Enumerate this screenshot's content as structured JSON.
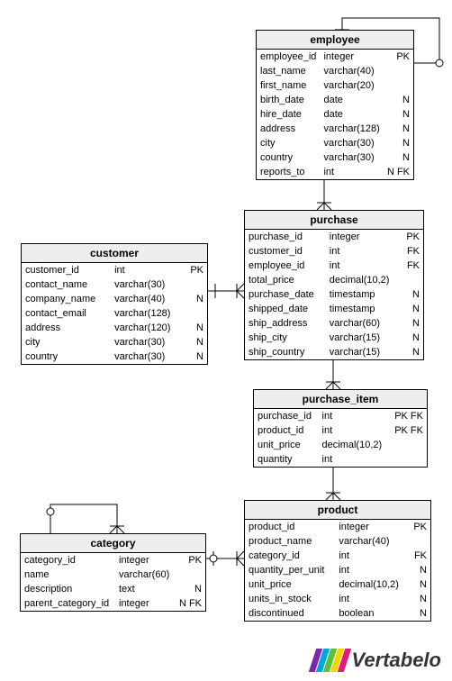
{
  "logo_text": "Vertabelo",
  "entities": {
    "employee": {
      "name": "employee",
      "columns": [
        {
          "name": "employee_id",
          "type": "integer",
          "flags": "PK"
        },
        {
          "name": "last_name",
          "type": "varchar(40)",
          "flags": ""
        },
        {
          "name": "first_name",
          "type": "varchar(20)",
          "flags": ""
        },
        {
          "name": "birth_date",
          "type": "date",
          "flags": "N"
        },
        {
          "name": "hire_date",
          "type": "date",
          "flags": "N"
        },
        {
          "name": "address",
          "type": "varchar(128)",
          "flags": "N"
        },
        {
          "name": "city",
          "type": "varchar(30)",
          "flags": "N"
        },
        {
          "name": "country",
          "type": "varchar(30)",
          "flags": "N"
        },
        {
          "name": "reports_to",
          "type": "int",
          "flags": "N FK"
        }
      ]
    },
    "customer": {
      "name": "customer",
      "columns": [
        {
          "name": "customer_id",
          "type": "int",
          "flags": "PK"
        },
        {
          "name": "contact_name",
          "type": "varchar(30)",
          "flags": ""
        },
        {
          "name": "company_name",
          "type": "varchar(40)",
          "flags": "N"
        },
        {
          "name": "contact_email",
          "type": "varchar(128)",
          "flags": ""
        },
        {
          "name": "address",
          "type": "varchar(120)",
          "flags": "N"
        },
        {
          "name": "city",
          "type": "varchar(30)",
          "flags": "N"
        },
        {
          "name": "country",
          "type": "varchar(30)",
          "flags": "N"
        }
      ]
    },
    "purchase": {
      "name": "purchase",
      "columns": [
        {
          "name": "purchase_id",
          "type": "integer",
          "flags": "PK"
        },
        {
          "name": "customer_id",
          "type": "int",
          "flags": "FK"
        },
        {
          "name": "employee_id",
          "type": "int",
          "flags": "FK"
        },
        {
          "name": "total_price",
          "type": "decimal(10,2)",
          "flags": ""
        },
        {
          "name": "purchase_date",
          "type": "timestamp",
          "flags": "N"
        },
        {
          "name": "shipped_date",
          "type": "timestamp",
          "flags": "N"
        },
        {
          "name": "ship_address",
          "type": "varchar(60)",
          "flags": "N"
        },
        {
          "name": "ship_city",
          "type": "varchar(15)",
          "flags": "N"
        },
        {
          "name": "ship_country",
          "type": "varchar(15)",
          "flags": "N"
        }
      ]
    },
    "purchase_item": {
      "name": "purchase_item",
      "columns": [
        {
          "name": "purchase_id",
          "type": "int",
          "flags": "PK FK"
        },
        {
          "name": "product_id",
          "type": "int",
          "flags": "PK FK"
        },
        {
          "name": "unit_price",
          "type": "decimal(10,2)",
          "flags": ""
        },
        {
          "name": "quantity",
          "type": "int",
          "flags": ""
        }
      ]
    },
    "product": {
      "name": "product",
      "columns": [
        {
          "name": "product_id",
          "type": "integer",
          "flags": "PK"
        },
        {
          "name": "product_name",
          "type": "varchar(40)",
          "flags": ""
        },
        {
          "name": "category_id",
          "type": "int",
          "flags": "FK"
        },
        {
          "name": "quantity_per_unit",
          "type": "int",
          "flags": "N"
        },
        {
          "name": "unit_price",
          "type": "decimal(10,2)",
          "flags": "N"
        },
        {
          "name": "units_in_stock",
          "type": "int",
          "flags": "N"
        },
        {
          "name": "discontinued",
          "type": "boolean",
          "flags": "N"
        }
      ]
    },
    "category": {
      "name": "category",
      "columns": [
        {
          "name": "category_id",
          "type": "integer",
          "flags": "PK"
        },
        {
          "name": "name",
          "type": "varchar(60)",
          "flags": ""
        },
        {
          "name": "description",
          "type": "text",
          "flags": "N"
        },
        {
          "name": "parent_category_id",
          "type": "integer",
          "flags": "N FK"
        }
      ]
    }
  },
  "relationships": [
    {
      "from": "employee.reports_to",
      "to": "employee.employee_id",
      "kind": "self"
    },
    {
      "from": "purchase.employee_id",
      "to": "employee.employee_id"
    },
    {
      "from": "purchase.customer_id",
      "to": "customer.customer_id"
    },
    {
      "from": "purchase_item.purchase_id",
      "to": "purchase.purchase_id"
    },
    {
      "from": "purchase_item.product_id",
      "to": "product.product_id"
    },
    {
      "from": "product.category_id",
      "to": "category.category_id"
    },
    {
      "from": "category.parent_category_id",
      "to": "category.category_id",
      "kind": "self"
    }
  ]
}
